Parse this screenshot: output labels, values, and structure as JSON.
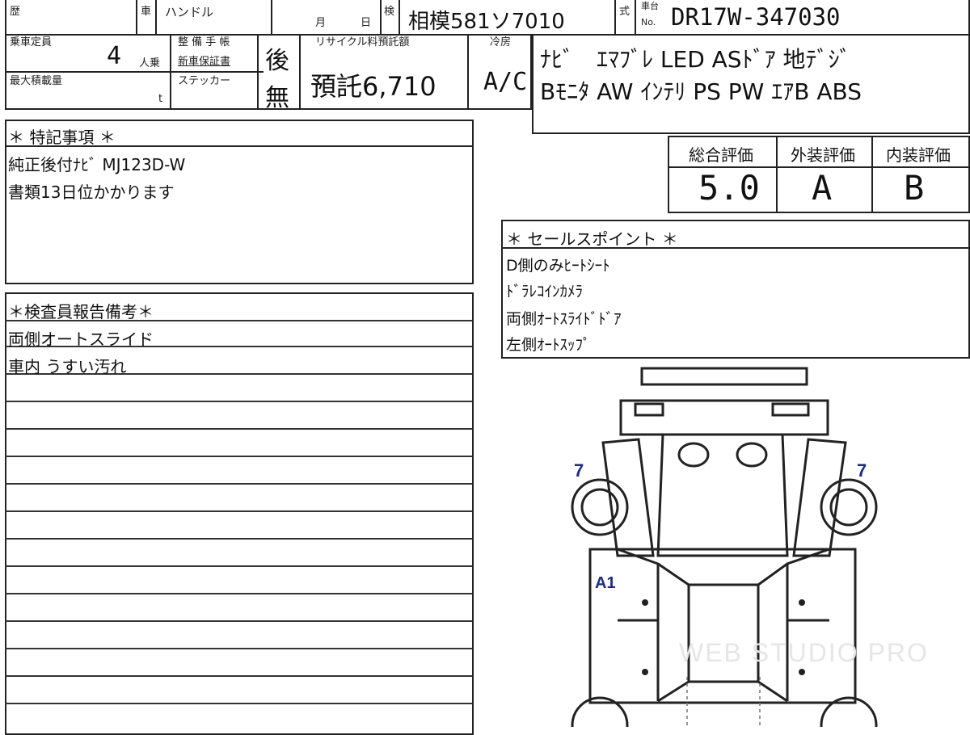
{
  "header": {
    "history_label": "歴",
    "car_label": "車",
    "handle_label": "ハンドル",
    "month_label": "月",
    "day_label": "日",
    "inspection_label": "検",
    "plate": "相模581ソ7010",
    "model_label": "式",
    "chassis_label_top": "車台",
    "chassis_label_bottom": "No.",
    "chassis_no": "DR17W-347030"
  },
  "specs": {
    "capacity_label": "乗車定員",
    "capacity_value": "4",
    "capacity_unit": "人乗",
    "maint_label": "整 備 手 帳",
    "warranty_label": "新車保証書",
    "maint_value": "後",
    "max_load_label": "最大積載量",
    "max_load_unit": "t",
    "sticker_label": "ステッカー",
    "sticker_value": "無",
    "recycle_label": "リサイクル料預託額",
    "recycle_value": "預託6,710",
    "cooler_label": "冷房",
    "cooler_value": "A/C",
    "options_line1": "ﾅﾋﾞ　ｴﾏﾌﾞﾚ LED ASﾄﾞｱ 地ﾃﾞｼﾞ",
    "options_line2": "Bﾓﾆﾀ AW ｲﾝﾃﾘ PS PW ｴｱB ABS"
  },
  "special_notes": {
    "title": "＊ 特記事項 ＊",
    "lines": [
      "純正後付ﾅﾋﾞ MJ123D-W",
      "書類13日位かかります"
    ]
  },
  "ratings": {
    "overall_label": "総合評価",
    "exterior_label": "外装評価",
    "interior_label": "内装評価",
    "overall_value": "5.0",
    "exterior_value": "A",
    "interior_value": "B"
  },
  "sales_points": {
    "title": "＊ セールスポイント ＊",
    "lines": [
      "D側のみﾋｰﾄｼｰﾄ",
      "ﾄﾞﾗﾚｺｲﾝｶﾒﾗ",
      "両側ｵｰﾄｽﾗｲﾄﾞﾄﾞｱ",
      "左側ｵｰﾄｽｯﾌﾟ"
    ]
  },
  "inspector_report": {
    "title": "＊検査員報告備考＊",
    "lines": [
      "両側オートスライド",
      "車内 うすい汚れ"
    ]
  },
  "diagram": {
    "mark_front_left": "7",
    "mark_front_right": "7",
    "mark_side": "A1",
    "mark_color": "#1a2a8a"
  },
  "watermark": "WEB STUDIO PRO"
}
